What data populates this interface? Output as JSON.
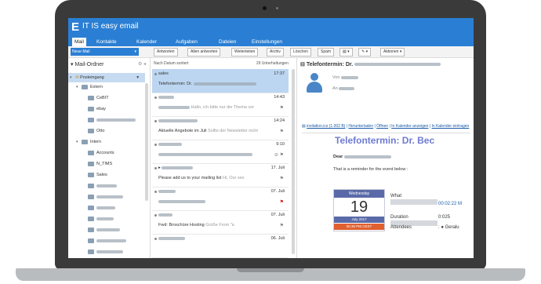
{
  "app": {
    "logo": "E",
    "title": "IT IS easy email"
  },
  "menu_tabs": [
    "Mail",
    "Kontakte",
    "Kalender",
    "Aufgaben",
    "Dateien",
    "Einstellungen"
  ],
  "toolbar": {
    "new_mail": "Neue Mail",
    "buttons": [
      "Antworten",
      "Allen antworten",
      "Weiterleiten",
      "Archiv",
      "Löschen",
      "Spam",
      "Aktionen"
    ]
  },
  "folders": {
    "header": "Mail-Ordner",
    "items": [
      {
        "label": "Posteingang",
        "level": 0,
        "selected": true
      },
      {
        "label": "Extern",
        "level": 1
      },
      {
        "label": "CeBIT",
        "level": 2
      },
      {
        "label": "ebay",
        "level": 2
      },
      {
        "label": "",
        "level": 2,
        "blurred": true
      },
      {
        "label": "Otto",
        "level": 2
      },
      {
        "label": "Intern",
        "level": 1
      },
      {
        "label": "Accounts",
        "level": 2
      },
      {
        "label": "N_TIMS",
        "level": 2
      },
      {
        "label": "Sales",
        "level": 2
      }
    ]
  },
  "message_list": {
    "sort_label": "Nach Datum sortiert",
    "count_label": "29 Unterhaltungen",
    "messages": [
      {
        "from": "sales",
        "date": "17:37",
        "preview": "Telefontermin: Dr.",
        "selected": true
      },
      {
        "from": "",
        "date": "14:43",
        "preview": "Hallo, ich bitte nur die Thema vor"
      },
      {
        "from": "",
        "date": "14:24",
        "preview": "Aktuelle Angebote im Juli",
        "preview2": "Sollte der Newsletter nicht"
      },
      {
        "from": "",
        "date": "9:10",
        "preview": ""
      },
      {
        "from": "",
        "date": "17. Juli",
        "preview": "Please add us to your mailing list",
        "preview2": "Hi, Our ses"
      },
      {
        "from": "",
        "date": "07. Juli",
        "preview": "",
        "flag": "red"
      },
      {
        "from": "",
        "date": "07. Juli",
        "preview": "Fwd: Broschüre Hosting",
        "preview2": "Grüße From \"a"
      },
      {
        "from": "",
        "date": "06. Juli",
        "preview": ""
      }
    ]
  },
  "reading": {
    "subject": "Telefontermin: Dr.",
    "von_label": "Von",
    "an_label": "An",
    "attachment": "invitation.ics (1.002 B)",
    "attachment_links": [
      "Herunterladen",
      "Öffnen",
      "In Kalender anzeigen",
      "In Kalender eintragen"
    ],
    "big_title": "Telefontermin: Dr. Bec",
    "dear": "Dear",
    "reminder": "That is a reminder for the event below :",
    "calendar": {
      "weekday": "Wednesday",
      "day": "19",
      "month": "July 2017",
      "time": "05:30 PM CEST"
    },
    "event": {
      "what_label": "What",
      "when_value": "00:02:22 M",
      "duration_label": "Duration",
      "duration_value": "0:025",
      "attendees_label": "Attendees",
      "attendees_value": "Geralu"
    }
  }
}
